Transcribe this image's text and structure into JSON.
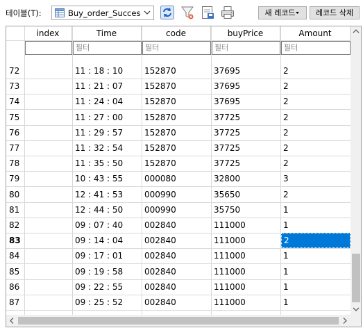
{
  "toolbar": {
    "table_label": "테이블(T):",
    "table_select": "Buy_order_Succes",
    "new_record_label": "새 레코드",
    "delete_record_label": "레코드 삭제"
  },
  "columns": [
    {
      "key": "index",
      "label": "index",
      "filter": ""
    },
    {
      "key": "time",
      "label": "Time",
      "filter": "필터"
    },
    {
      "key": "code",
      "label": "code",
      "filter": "필터"
    },
    {
      "key": "buyPrice",
      "label": "buyPrice",
      "filter": "필터"
    },
    {
      "key": "amount",
      "label": "Amount",
      "filter": "필터"
    }
  ],
  "rows": [
    {
      "num": "72",
      "index": "",
      "time": "11 : 18 : 10",
      "code": "152870",
      "buyPrice": "37695",
      "amount": "2"
    },
    {
      "num": "73",
      "index": "",
      "time": "11 : 21 : 07",
      "code": "152870",
      "buyPrice": "37695",
      "amount": "2"
    },
    {
      "num": "74",
      "index": "",
      "time": "11 : 24 : 04",
      "code": "152870",
      "buyPrice": "37695",
      "amount": "2"
    },
    {
      "num": "75",
      "index": "",
      "time": "11 : 27 : 00",
      "code": "152870",
      "buyPrice": "37725",
      "amount": "2"
    },
    {
      "num": "76",
      "index": "",
      "time": "11 : 29 : 57",
      "code": "152870",
      "buyPrice": "37725",
      "amount": "2"
    },
    {
      "num": "77",
      "index": "",
      "time": "11 : 32 : 54",
      "code": "152870",
      "buyPrice": "37725",
      "amount": "2"
    },
    {
      "num": "78",
      "index": "",
      "time": "11 : 35 : 50",
      "code": "152870",
      "buyPrice": "37725",
      "amount": "2"
    },
    {
      "num": "79",
      "index": "",
      "time": "10 : 43 : 55",
      "code": "000080",
      "buyPrice": "32800",
      "amount": "3"
    },
    {
      "num": "80",
      "index": "",
      "time": "12 : 41 : 53",
      "code": "000990",
      "buyPrice": "35650",
      "amount": "2"
    },
    {
      "num": "81",
      "index": "",
      "time": "12 : 44 : 50",
      "code": "000990",
      "buyPrice": "35750",
      "amount": "1"
    },
    {
      "num": "82",
      "index": "",
      "time": "09 : 07 : 40",
      "code": "002840",
      "buyPrice": "111000",
      "amount": "1"
    },
    {
      "num": "83",
      "index": "",
      "time": "09 : 14 : 04",
      "code": "002840",
      "buyPrice": "111000",
      "amount": "2"
    },
    {
      "num": "84",
      "index": "",
      "time": "09 : 17 : 01",
      "code": "002840",
      "buyPrice": "111000",
      "amount": "1"
    },
    {
      "num": "85",
      "index": "",
      "time": "09 : 19 : 58",
      "code": "002840",
      "buyPrice": "111000",
      "amount": "1"
    },
    {
      "num": "86",
      "index": "",
      "time": "09 : 22 : 55",
      "code": "002840",
      "buyPrice": "111000",
      "amount": "1"
    },
    {
      "num": "87",
      "index": "",
      "time": "09 : 25 : 52",
      "code": "002840",
      "buyPrice": "111000",
      "amount": "1"
    }
  ],
  "selection": {
    "row_num": "83",
    "column": "amount"
  },
  "icons": [
    "table-icon",
    "dropdown-arrow-icon",
    "refresh-icon",
    "clear-filter-icon",
    "save-icon",
    "print-icon",
    "menu-arrow-icon"
  ],
  "colors": {
    "selection": "#0078d7",
    "button_face": "#e1e1e1",
    "scrollbar": "#f0f0f0"
  }
}
